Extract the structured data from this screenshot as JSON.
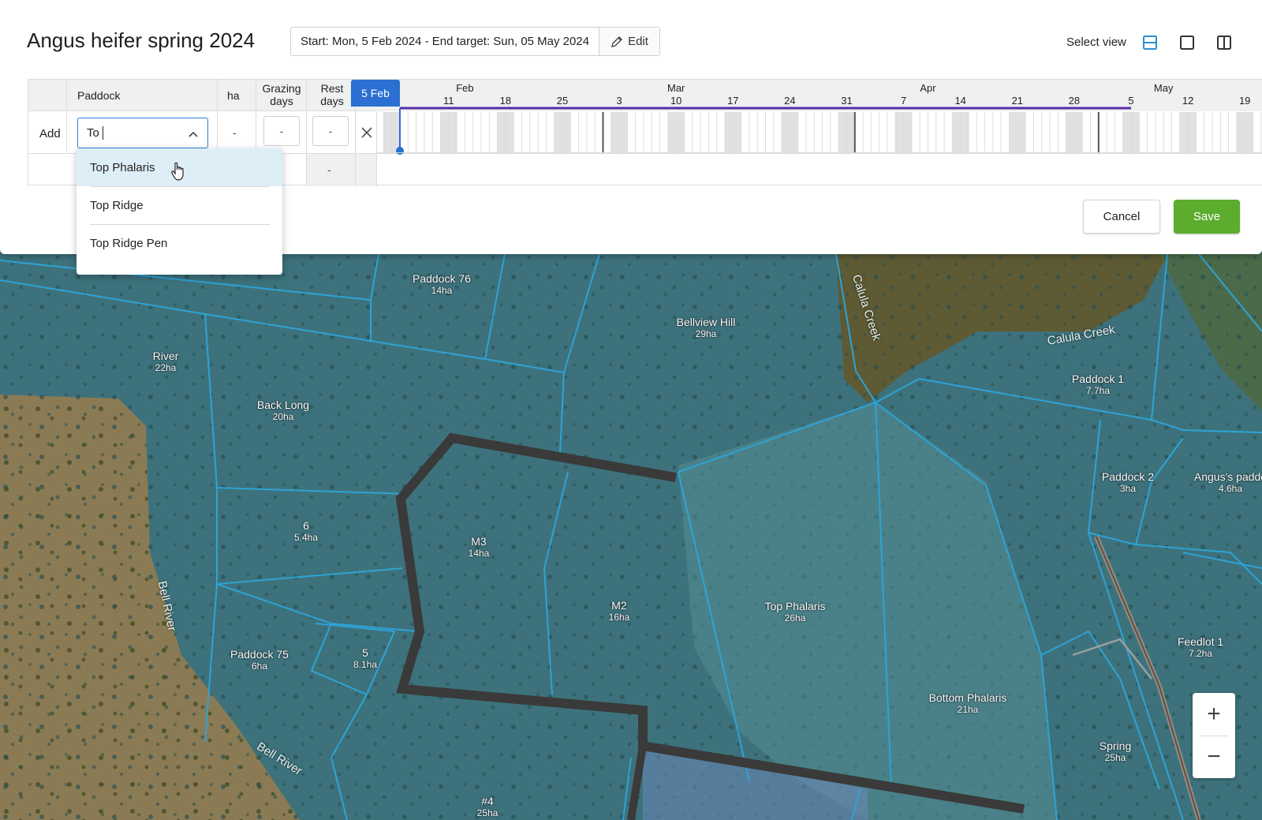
{
  "plan": {
    "title": "Angus heifer spring 2024",
    "date_range": "Start: Mon, 5 Feb 2024 - End target: Sun, 05 May 2024",
    "edit_label": "Edit",
    "select_view_label": "Select view",
    "views": [
      {
        "icon": "split-horizontal-icon",
        "active": true
      },
      {
        "icon": "single-panel-icon",
        "active": false
      },
      {
        "icon": "split-vertical-icon",
        "active": false
      }
    ]
  },
  "table": {
    "headers": {
      "paddock": "Paddock",
      "ha": "ha",
      "grazing_days": "Grazing days",
      "rest_days": "Rest days"
    },
    "add_label": "Add",
    "paddock_input": "To",
    "ha_value": "-",
    "grazing_days_value": "-",
    "rest_days_value": "-",
    "rest_days_row2": "-"
  },
  "timeline": {
    "today_label": "5 Feb",
    "months": [
      "Feb",
      "Mar",
      "Apr",
      "May"
    ],
    "week_ticks": [
      "11",
      "18",
      "25",
      "3",
      "10",
      "17",
      "24",
      "31",
      "7",
      "14",
      "21",
      "28",
      "5",
      "12",
      "19"
    ]
  },
  "dropdown": {
    "options": [
      "Top Phalaris",
      "Top Ridge",
      "Top Ridge Pen"
    ]
  },
  "actions": {
    "cancel": "Cancel",
    "save": "Save"
  },
  "map": {
    "paddocks": [
      {
        "name": "Paddock 76",
        "area": "14ha"
      },
      {
        "name": "Bellview Hill",
        "area": "29ha"
      },
      {
        "name": "River",
        "area": "22ha"
      },
      {
        "name": "Back Long",
        "area": "20ha"
      },
      {
        "name": "Paddock 1",
        "area": "7.7ha"
      },
      {
        "name": "Paddock 2",
        "area": "3ha"
      },
      {
        "name": "Angus's paddo",
        "area": "4.6ha"
      },
      {
        "name": "6",
        "area": "5.4ha"
      },
      {
        "name": "M3",
        "area": "14ha"
      },
      {
        "name": "M2",
        "area": "16ha"
      },
      {
        "name": "Top Phalaris",
        "area": "26ha"
      },
      {
        "name": "Paddock 75",
        "area": "6ha"
      },
      {
        "name": "5",
        "area": "8.1ha"
      },
      {
        "name": "Feedlot 1",
        "area": "7.2ha"
      },
      {
        "name": "Bottom Phalaris",
        "area": "21ha"
      },
      {
        "name": "Spring",
        "area": "25ha"
      },
      {
        "name": "#4",
        "area": "25ha"
      }
    ],
    "features": [
      "Calula Creek",
      "Calula Creek",
      "Bell River",
      "Bell River"
    ],
    "zoom_in": "+",
    "zoom_out": "−",
    "colors": {
      "fill": "#3f7a85",
      "boundary": "#2ea3d6",
      "fence": "#3a3a3a",
      "land": "#8a7a52"
    }
  }
}
